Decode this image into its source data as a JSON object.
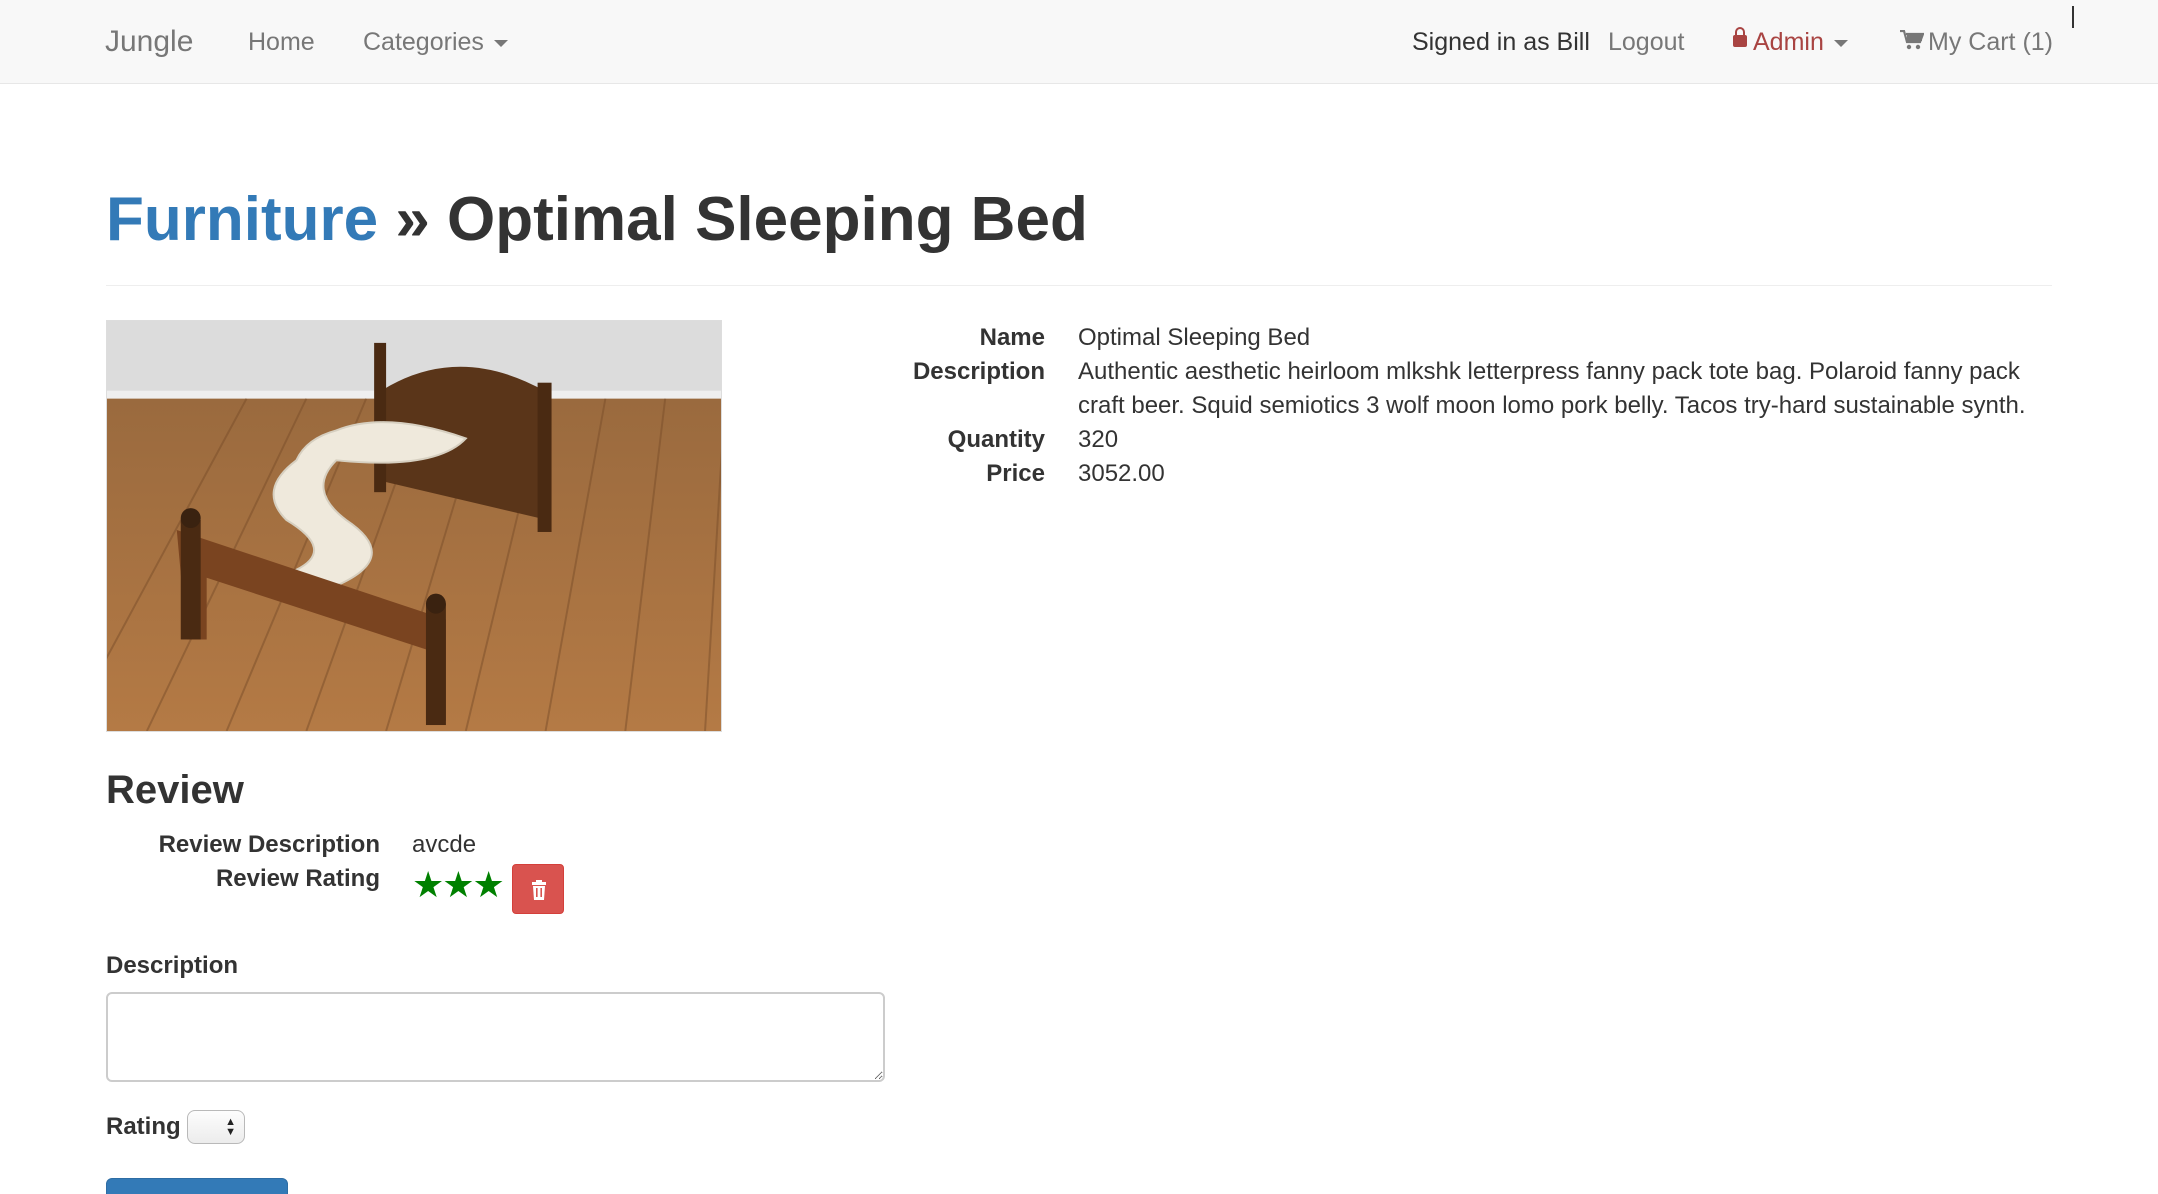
{
  "navbar": {
    "brand": "Jungle",
    "home": "Home",
    "categories": "Categories",
    "signed_in": "Signed in as Bill",
    "logout": "Logout",
    "admin": "Admin",
    "cart": "My Cart (1)"
  },
  "header": {
    "category": "Furniture",
    "separator": " » ",
    "product": "Optimal Sleeping Bed"
  },
  "product": {
    "image_alt": "bed-photo",
    "labels": {
      "name": "Name",
      "description": "Description",
      "quantity": "Quantity",
      "price": "Price"
    },
    "name": "Optimal Sleeping Bed",
    "description_line1": "Authentic aesthetic heirloom mlkshk letterpress fanny pack tote bag. Polaroid fanny pack",
    "description_line2": "craft beer. Squid semiotics 3 wolf moon lomo pork belly. Tacos try-hard sustainable synth.",
    "quantity": "320",
    "price": "3052.00"
  },
  "review": {
    "heading": "Review",
    "description_label": "Review Description",
    "description_value": "avcde",
    "rating_label": "Review Rating",
    "rating_stars": "★★★",
    "rating_value": 3,
    "star_color": "#008000"
  },
  "form": {
    "description_label": "Description",
    "description_value": "",
    "rating_label": "Rating",
    "rating_value": ""
  },
  "colors": {
    "link": "#337ab7",
    "admin": "#a94442",
    "danger": "#d9534f",
    "primary": "#337ab7"
  }
}
